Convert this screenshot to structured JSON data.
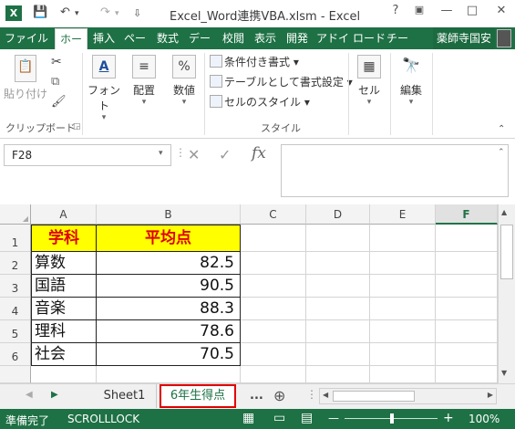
{
  "window": {
    "title": "Excel_Word連携VBA.xlsm - Excel",
    "help": "?",
    "min": "—",
    "max": "□",
    "close": "✕"
  },
  "qat": {
    "save": "💾",
    "undo": "↶",
    "redo": "↷",
    "more": "⇩"
  },
  "tabs": [
    "ファイル",
    "ホー",
    "挿入",
    "ペー",
    "数式",
    "デー",
    "校閲",
    "表示",
    "開発",
    "アドイ",
    "ロード",
    "チー"
  ],
  "user_name": "薬師寺国安",
  "ribbon": {
    "paste_label": "貼り付け",
    "clipboard_label": "クリップボード",
    "font_label": "フォント",
    "align_label": "配置",
    "number_label": "数値",
    "number_icon": "%",
    "cond_format": "条件付き書式 ▾",
    "table_format": "テーブルとして書式設定 ▾",
    "cell_style": "セルのスタイル ▾",
    "style_label": "スタイル",
    "cells_label": "セル",
    "edit_label": "編集"
  },
  "namebox": "F28",
  "fx_symbol": "fx",
  "columns": [
    "A",
    "B",
    "C",
    "D",
    "E",
    "F"
  ],
  "rows": [
    "1",
    "2",
    "3",
    "4",
    "5",
    "6"
  ],
  "headers": {
    "a1": "学科",
    "b1": "平均点"
  },
  "data_rows": [
    {
      "subject": "算数",
      "score": "82.5"
    },
    {
      "subject": "国語",
      "score": "90.5"
    },
    {
      "subject": "音楽",
      "score": "88.3"
    },
    {
      "subject": "理科",
      "score": "78.6"
    },
    {
      "subject": "社会",
      "score": "70.5"
    }
  ],
  "sheets": {
    "sheet1": "Sheet1",
    "sheet2": "6年生得点",
    "more": "...",
    "add": "⊕"
  },
  "status": {
    "ready": "準備完了",
    "scroll": "SCROLLLOCK",
    "minus": "—",
    "plus": "+",
    "zoom": "100%"
  },
  "colors": {
    "excel_green": "#1e7145",
    "header_fill": "#ffff00",
    "header_text": "#e00000",
    "tab_highlight": "#e00000"
  }
}
